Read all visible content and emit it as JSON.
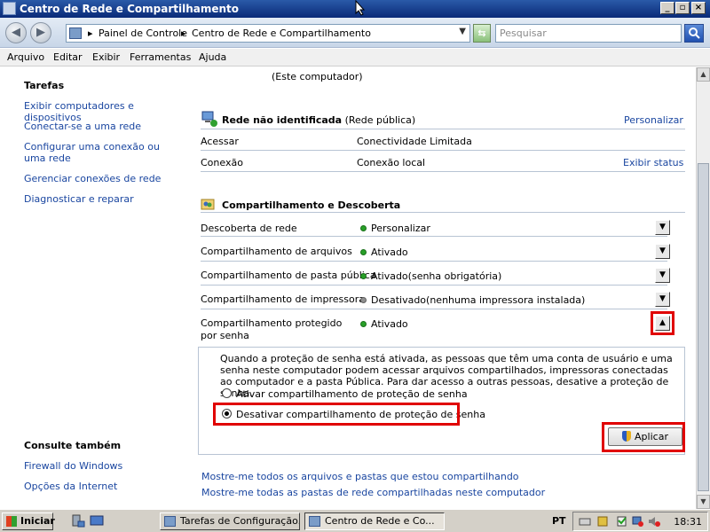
{
  "window": {
    "title": "Centro de Rede e Compartilhamento"
  },
  "address": {
    "crumb1": "Painel de Controle",
    "crumb2": "Centro de Rede e Compartilhamento",
    "search_placeholder": "Pesquisar"
  },
  "menu": [
    "Arquivo",
    "Editar",
    "Exibir",
    "Ferramentas",
    "Ajuda"
  ],
  "sidebar": {
    "tasks_heading": "Tarefas",
    "tasks": [
      "Exibir computadores e dispositivos",
      "Conectar-se a uma rede",
      "Configurar uma conexão ou uma rede",
      "Gerenciar conexões de rede",
      "Diagnosticar e reparar"
    ],
    "see_also_heading": "Consulte também",
    "see_also": [
      "Firewall do Windows",
      "Opções da Internet"
    ]
  },
  "map": {
    "computer_caption": "(Este computador)"
  },
  "network": {
    "name": "Rede não identificada",
    "type": "(Rede pública)",
    "customize": "Personalizar",
    "rows": [
      {
        "label": "Acessar",
        "value": "Conectividade Limitada",
        "action": ""
      },
      {
        "label": "Conexão",
        "value": "Conexão local",
        "action": "Exibir status"
      }
    ]
  },
  "sharing": {
    "heading": "Compartilhamento e Descoberta",
    "rows": [
      {
        "label": "Descoberta de rede",
        "status": "Personalizar",
        "note": "",
        "state": "on",
        "expander": "▼"
      },
      {
        "label": "Compartilhamento de arquivos",
        "status": "Ativado",
        "note": "",
        "state": "on",
        "expander": "▼"
      },
      {
        "label": "Compartilhamento de pasta pública",
        "status": "Ativado",
        "note": "(senha obrigatória)",
        "state": "on",
        "expander": "▼"
      },
      {
        "label": "Compartilhamento de impressora",
        "status": "Desativado",
        "note": "(nenhuma impressora instalada)",
        "state": "off",
        "expander": "▼"
      },
      {
        "label": "Compartilhamento protegido por senha",
        "status": "Ativado",
        "note": "",
        "state": "on",
        "expander": "▲"
      }
    ],
    "description": "Quando a proteção de senha está ativada, as pessoas que têm uma conta de usuário e uma senha neste computador podem acessar arquivos compartilhados, impressoras conectadas ao computador e a pasta Pública. Para dar acesso a outras pessoas, desative a proteção de senha.",
    "option_on": "Ativar compartilhamento de proteção de senha",
    "option_off": "Desativar compartilhamento de proteção de senha",
    "selected": "off",
    "apply": "Aplicar"
  },
  "bottom_links": [
    "Mostre-me todos os arquivos e pastas que estou compartilhando",
    "Mostre-me todas as pastas de rede compartilhadas neste computador"
  ],
  "taskbar": {
    "start": "Iniciar",
    "tasks": [
      "Tarefas de Configuração...",
      "Centro de Rede e Co..."
    ],
    "language": "PT",
    "clock": "18:31"
  },
  "colors": {
    "highlight": "#e00000",
    "link": "#1a46a0",
    "title_bar": "#0a2a78"
  }
}
